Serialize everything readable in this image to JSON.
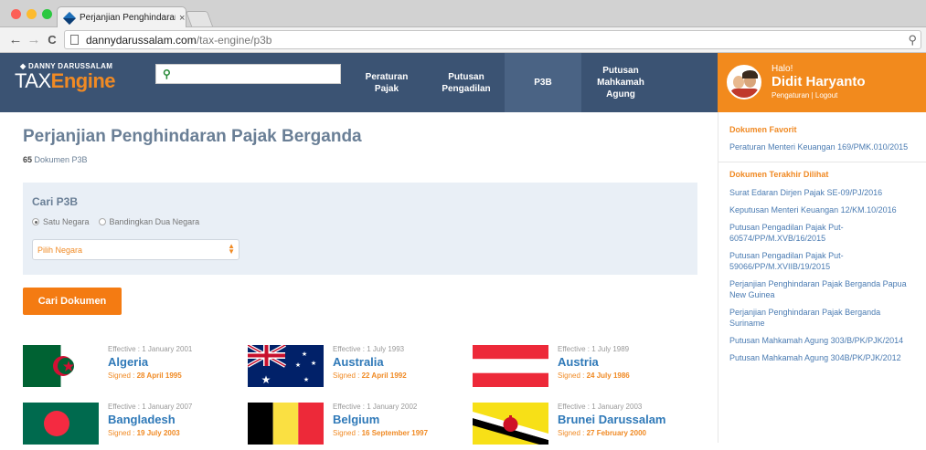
{
  "browser": {
    "tab_title": "Perjanjian Penghindaran Pajak",
    "tab_close": "×",
    "url_host": "dannydarussalam.com",
    "url_path": "/tax-engine/p3b"
  },
  "header": {
    "logo_small": "DANNY DARUSSALAM",
    "logo_tax": "TAX",
    "logo_engine": "Engine",
    "search_placeholder": "",
    "nav": {
      "peraturan": "Peraturan Pajak",
      "putusan": "Putusan Pengadilan",
      "p3b": "P3B",
      "mahkamah": "Putusan Mahkamah Agung"
    },
    "user": {
      "greeting": "Halo!",
      "name": "Didit Haryanto",
      "links": "Pengaturan | Logout"
    }
  },
  "main": {
    "title": "Perjanjian Penghindaran Pajak Berganda",
    "count": "65",
    "count_label": "Dokumen P3B",
    "search": {
      "title": "Cari P3B",
      "radio1": "Satu Negara",
      "radio2": "Bandingkan Dua Negara",
      "select_value": "Pilih Negara",
      "button": "Cari Dokumen"
    },
    "countries": [
      {
        "name": "Algeria",
        "effective": "Effective : 1 January 2001",
        "signed_label": "Signed :",
        "signed": "28 April 1995"
      },
      {
        "name": "Australia",
        "effective": "Effective : 1 July 1993",
        "signed_label": "Signed :",
        "signed": "22 April 1992"
      },
      {
        "name": "Austria",
        "effective": "Effective : 1 July 1989",
        "signed_label": "Signed :",
        "signed": "24 July 1986"
      },
      {
        "name": "Bangladesh",
        "effective": "Effective : 1 January 2007",
        "signed_label": "Signed :",
        "signed": "19 July 2003"
      },
      {
        "name": "Belgium",
        "effective": "Effective : 1 January 2002",
        "signed_label": "Signed :",
        "signed": "16 September 1997"
      },
      {
        "name": "Brunei Darussalam",
        "effective": "Effective : 1 January 2003",
        "signed_label": "Signed :",
        "signed": "27 February 2000"
      }
    ]
  },
  "sidebar": {
    "favorites_title": "Dokumen Favorit",
    "favorites": [
      "Peraturan Menteri Keuangan 169/PMK.010/2015"
    ],
    "recent_title": "Dokumen Terakhir Dilihat",
    "recent": [
      "Surat Edaran Dirjen Pajak SE-09/PJ/2016",
      "Keputusan Menteri Keuangan 12/KM.10/2016",
      "Putusan Pengadilan Pajak Put-60574/PP/M.XVB/16/2015",
      "Putusan Pengadilan Pajak Put-59066/PP/M.XVIIB/19/2015",
      "Perjanjian Penghindaran Pajak Berganda Papua New Guinea",
      "Perjanjian Penghindaran Pajak Berganda Suriname",
      "Putusan Mahkamah Agung 303/B/PK/PJK/2014",
      "Putusan Mahkamah Agung 304B/PK/PJK/2012"
    ]
  },
  "colors": {
    "header_bg": "#3b5373",
    "accent": "#f08a24",
    "link": "#2f79b8"
  }
}
